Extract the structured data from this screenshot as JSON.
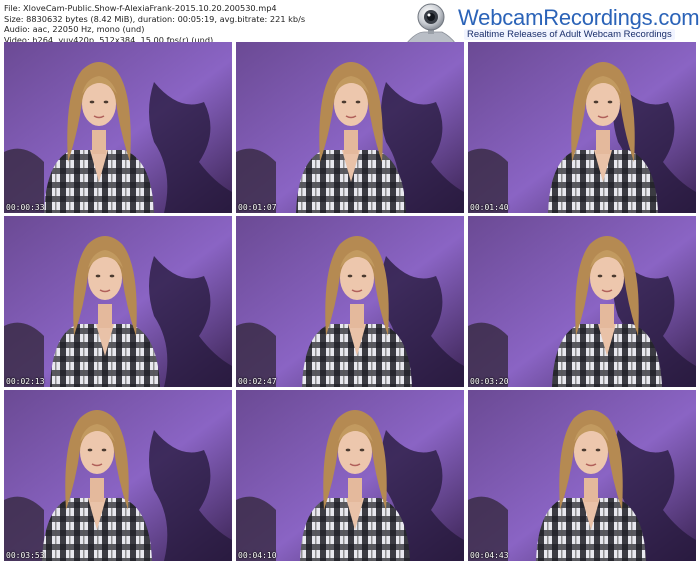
{
  "file_info": {
    "file": "File: XloveCam-Public.Show-f-AlexiaFrank-2015.10.20.200530.mp4",
    "size": "Size: 8830632 bytes (8.42 MiB), duration: 00:05:19, avg.bitrate: 221 kb/s",
    "audio": "Audio: aac, 22050 Hz, mono (und)",
    "video": "Video: h264, yuv420p, 512x384, 15.00 fps(r) (und)"
  },
  "logo": {
    "brand": "WebcamRecordings.com",
    "tagline": "Realtime Releases of Adult Webcam Recordings"
  },
  "thumbnails": [
    {
      "timestamp": "00:00:33"
    },
    {
      "timestamp": "00:01:07"
    },
    {
      "timestamp": "00:01:40"
    },
    {
      "timestamp": "00:02:13"
    },
    {
      "timestamp": "00:02:47"
    },
    {
      "timestamp": "00:03:20"
    },
    {
      "timestamp": "00:03:53"
    },
    {
      "timestamp": "00:04:10"
    },
    {
      "timestamp": "00:04:43"
    }
  ]
}
